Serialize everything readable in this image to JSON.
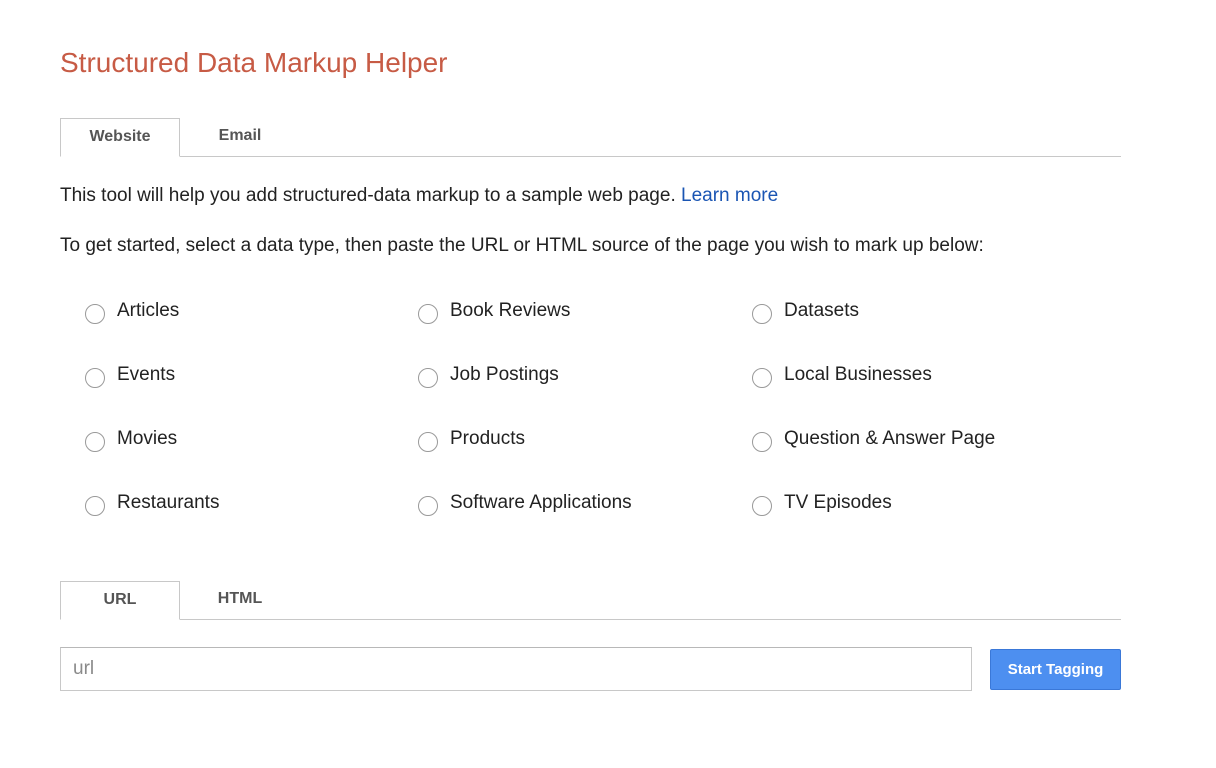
{
  "header": {
    "title": "Structured Data Markup Helper"
  },
  "source_tabs": [
    {
      "label": "Website",
      "active": true
    },
    {
      "label": "Email",
      "active": false
    }
  ],
  "intro": {
    "text": "This tool will help you add structured-data markup to a sample web page.",
    "learn_more": "Learn more"
  },
  "instructions": "To get started, select a data type, then paste the URL or HTML source of the page you wish to mark up below:",
  "data_types": [
    {
      "label": "Articles"
    },
    {
      "label": "Book Reviews"
    },
    {
      "label": "Datasets"
    },
    {
      "label": "Events"
    },
    {
      "label": "Job Postings"
    },
    {
      "label": "Local Businesses"
    },
    {
      "label": "Movies"
    },
    {
      "label": "Products"
    },
    {
      "label": "Question & Answer Page"
    },
    {
      "label": "Restaurants"
    },
    {
      "label": "Software Applications"
    },
    {
      "label": "TV Episodes"
    }
  ],
  "input_tabs": [
    {
      "label": "URL",
      "active": true
    },
    {
      "label": "HTML",
      "active": false
    }
  ],
  "url_input": {
    "placeholder": "url",
    "value": ""
  },
  "start_button": {
    "label": "Start Tagging"
  },
  "colors": {
    "title": "#c75b45",
    "link": "#1a55b3",
    "button": "#4d8ff0"
  }
}
